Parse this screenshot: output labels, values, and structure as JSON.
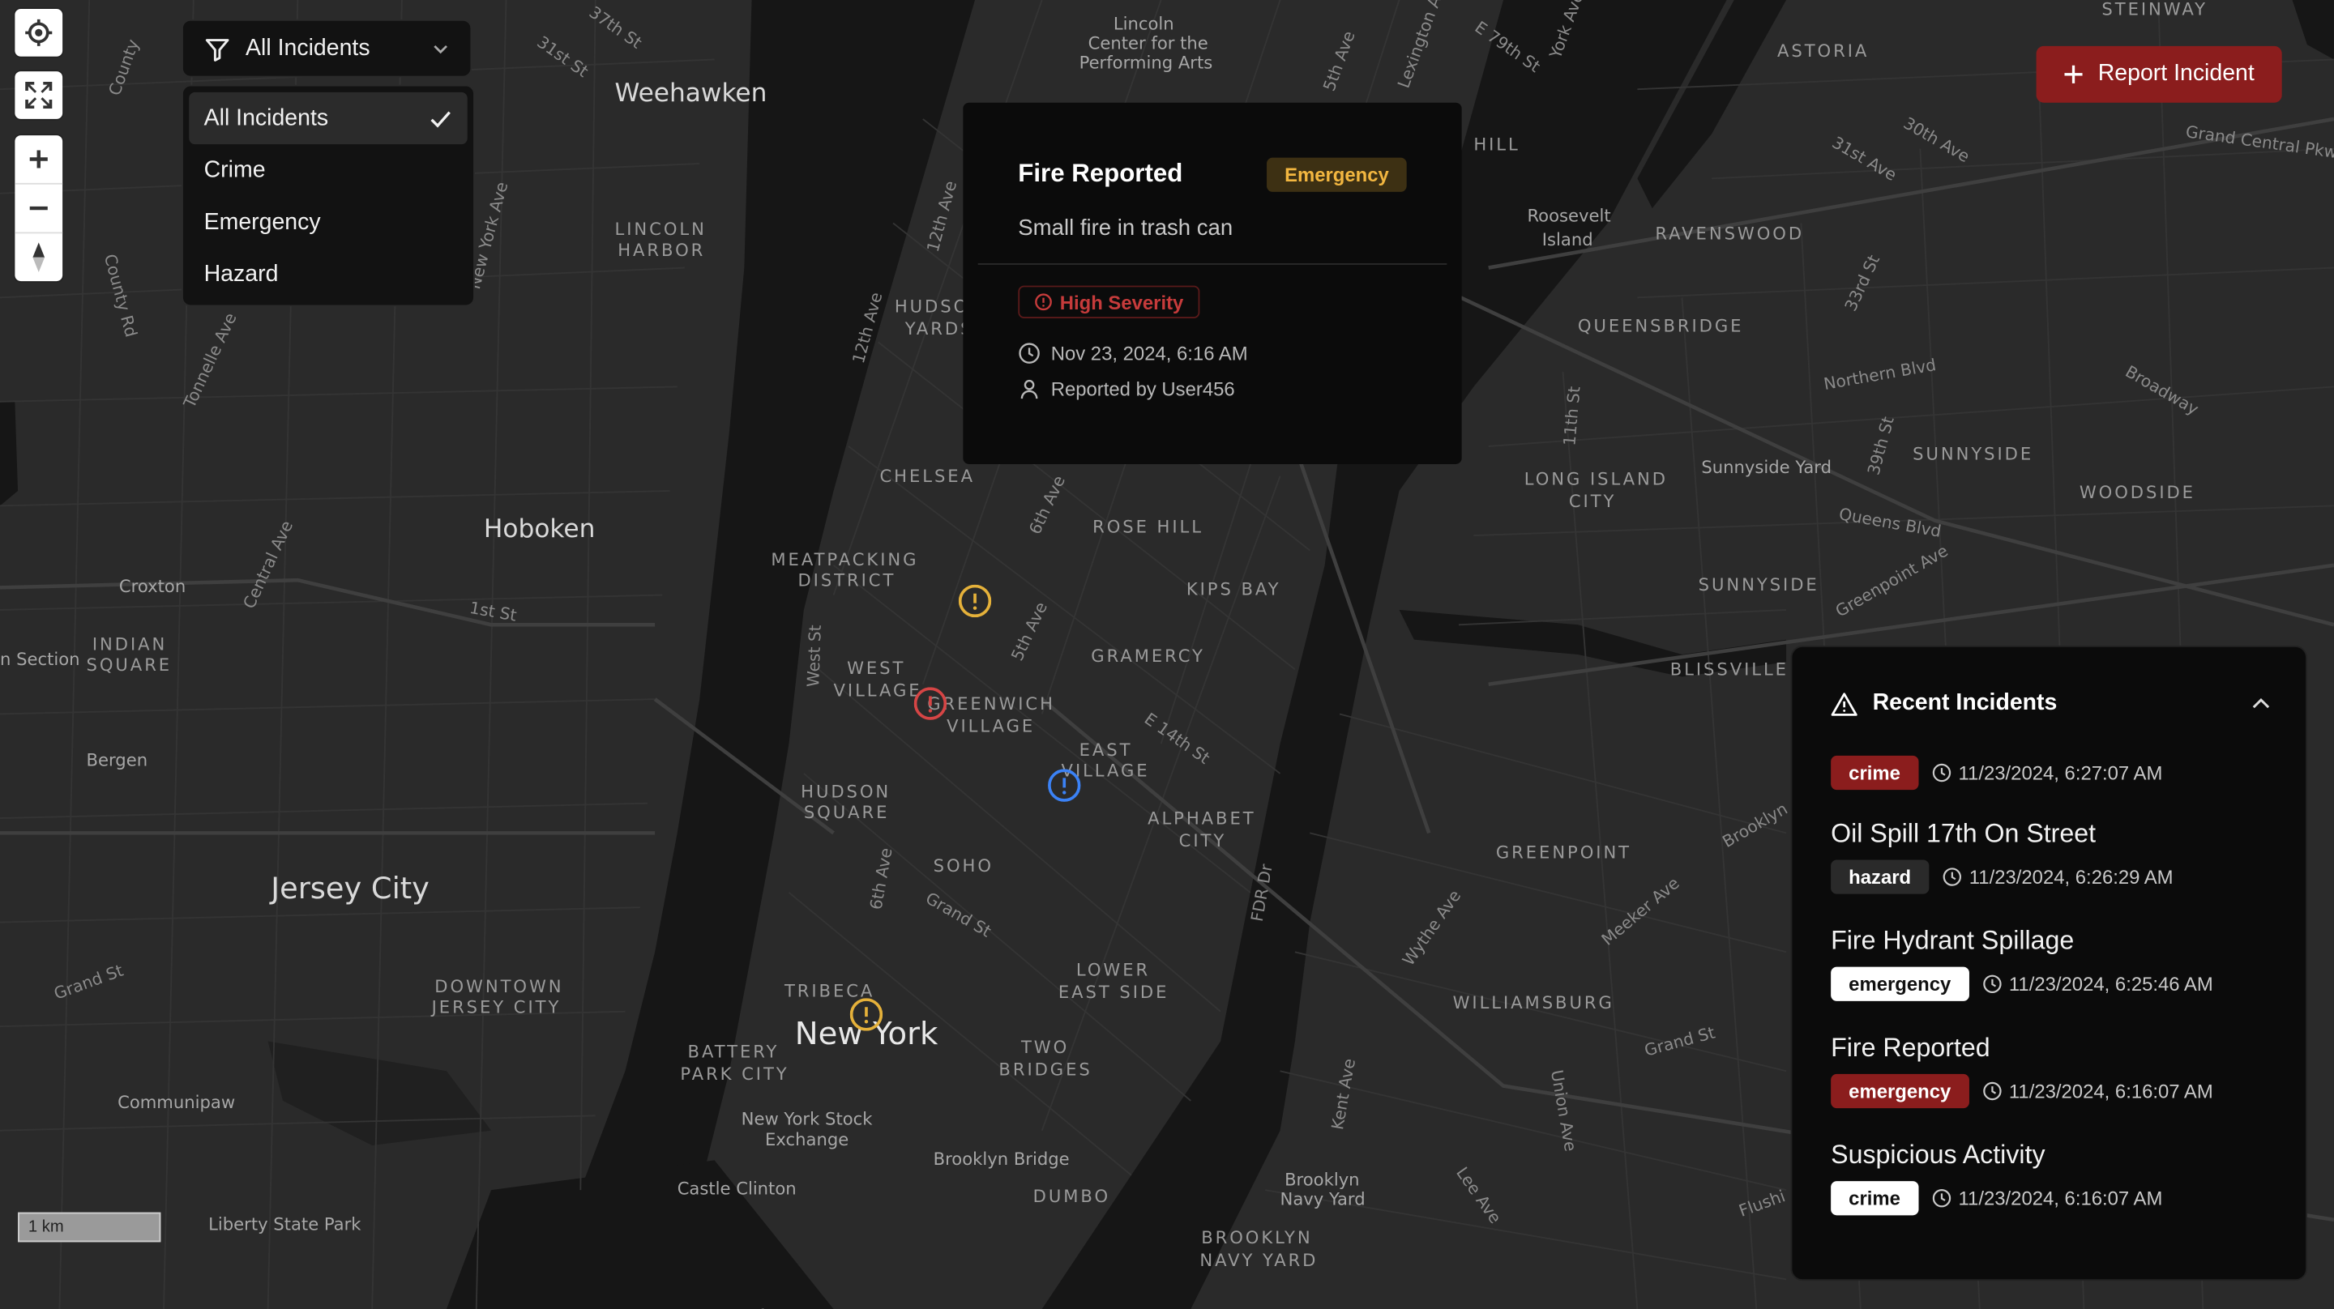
{
  "map": {
    "neighborhoods": [
      "Weehawken",
      "Hoboken",
      "Jersey City",
      "New York",
      "LINCOLN",
      "HARBOR",
      "CHELSEA",
      "MEATPACKING",
      "DISTRICT",
      "WEST",
      "VILLAGE",
      "GREENWICH",
      "VILLAGE",
      "EAST",
      "VILLAGE",
      "HUDSON",
      "SQUARE",
      "SOHO",
      "TRIBECA",
      "BATTERY",
      "PARK CITY",
      "TWO",
      "BRIDGES",
      "LOWER",
      "EAST SIDE",
      "ALPHABET",
      "CITY",
      "GRAMERCY",
      "KIPS BAY",
      "ROSE HILL",
      "LONG ISLAND",
      "CITY",
      "QUEENSBRIDGE",
      "RAVENSWOOD",
      "ASTORIA",
      "SUNNYSIDE",
      "WOODSIDE",
      "BLISSVILLE",
      "GREENPOINT",
      "WILLIAMSBURG",
      "DUMBO",
      "BROOKLYN",
      "NAVY YARD",
      "DOWNTOWN",
      "JERSEY CITY",
      "INDIAN",
      "SQUARE",
      "STEINWAY",
      "HUDSON",
      "YARDS"
    ],
    "places": [
      "Croxton",
      "Bergen",
      "Communipaw",
      "Liberty State Park",
      "Castle Clinton",
      "Brooklyn Bridge",
      "New York Stock",
      "Exchange",
      "Roosevelt",
      "Island",
      "Lincoln",
      "Center for the",
      "Performing Arts",
      "Sunnyside Yard",
      "Brooklyn",
      "Navy Yard",
      "n Section"
    ],
    "streets": [
      "37th St",
      "31st St",
      "County",
      "1st St",
      "Grand St",
      "Central Ave",
      "Tonnelle Ave",
      "New York Ave",
      "12th Ave",
      "11th Ave",
      "6th Ave",
      "5th Ave",
      "E 14th St",
      "FDR Dr",
      "West St",
      "Grand St",
      "6th Ave",
      "Kent Ave",
      "Wythe Ave",
      "Meeker Ave",
      "Union Ave",
      "Lee Ave",
      "Northern Blvd",
      "Queens Blvd",
      "Greenpoint Ave",
      "Broadway",
      "39th St",
      "33rd St",
      "11th St",
      "30th Ave",
      "31st Ave",
      "Grand Central Pkwy",
      "Brooklyn",
      "5th Ave",
      "E 79th St",
      "York Ave",
      "Lexington Ave",
      "County Rd",
      "Flushi",
      "Grand St"
    ],
    "scale_label": "1 km",
    "markers": [
      {
        "type": "warning",
        "color": "#e5b13a"
      },
      {
        "type": "danger",
        "color": "#d64545"
      },
      {
        "type": "info",
        "color": "#3b82f6"
      },
      {
        "type": "warning",
        "color": "#e5b13a"
      }
    ]
  },
  "filter": {
    "selected": "All Incidents",
    "options": [
      "All Incidents",
      "Crime",
      "Emergency",
      "Hazard"
    ]
  },
  "popup": {
    "title": "Fire Reported",
    "badge": "Emergency",
    "description": "Small fire in trash can",
    "severity": "High Severity",
    "datetime": "Nov 23, 2024, 6:16 AM",
    "reporter": "Reported by User456"
  },
  "report_button": "Report Incident",
  "recent": {
    "title": "Recent Incidents",
    "items": [
      {
        "title": "",
        "tag": "crime",
        "time": "11/23/2024, 6:27:07 AM"
      },
      {
        "title": "Oil Spill 17th On Street",
        "tag": "hazard",
        "time": "11/23/2024, 6:26:29 AM"
      },
      {
        "title": "Fire Hydrant Spillage",
        "tag": "emergency",
        "time": "11/23/2024, 6:25:46 AM"
      },
      {
        "title": "Fire Reported",
        "tag": "emergency",
        "time": "11/23/2024, 6:16:07 AM"
      },
      {
        "title": "Suspicious Activity",
        "tag": "crime",
        "time": "11/23/2024, 6:16:07 AM"
      }
    ]
  },
  "colors": {
    "accent_red": "#8b1d1d",
    "emergency_amber": "#f2b640",
    "severity_red": "#c63b3b",
    "map_land": "#2a2a2a",
    "map_water": "#161616"
  }
}
